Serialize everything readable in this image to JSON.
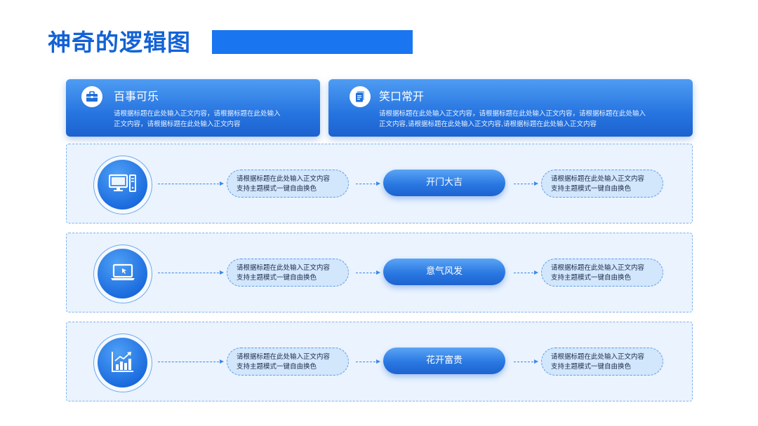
{
  "title": "神奇的逻辑图",
  "header_cards": [
    {
      "title": "百事可乐",
      "icon": "briefcase-icon",
      "body_lines": [
        "请根据标题在此处输入正文内容，请根据标题在此处输入",
        "正文内容，请根据标题在此处输入正文内容"
      ]
    },
    {
      "title": "笑口常开",
      "icon": "document-icon",
      "body_lines": [
        "请根据标题在此处输入正文内容，请根据标题在此处输入正文内容，请根据标题在此处输入",
        "正文内容,请根据标题在此处输入正文内容,请根据标题在此处输入正文内容"
      ]
    }
  ],
  "rows": [
    {
      "icon": "desktop-computer-icon",
      "left_lines": [
        "请根据标题在此处输入正文内容",
        "支持主题模式一键自由换色"
      ],
      "center_label": "开门大吉",
      "right_lines": [
        "请根据标题在此处输入正文内容",
        "支持主题模式一键自由换色"
      ]
    },
    {
      "icon": "laptop-icon",
      "left_lines": [
        "请根据标题在此处输入正文内容",
        "支持主题模式一键自由换色"
      ],
      "center_label": "意气风发",
      "right_lines": [
        "请根据标题在此处输入正文内容",
        "支持主题模式一键自由换色"
      ]
    },
    {
      "icon": "bar-chart-growth-icon",
      "left_lines": [
        "请根据标题在此处输入正文内容",
        "支持主题模式一键自由换色"
      ],
      "center_label": "花开富贵",
      "right_lines": [
        "请根据标题在此处输入正文内容",
        "支持主题模式一键自由换色"
      ]
    }
  ],
  "colors": {
    "title": "#1262d6",
    "accent": "#1a76f0",
    "panel_bg": "#eaf3fe",
    "pill_bg": "#d2e6fc"
  }
}
